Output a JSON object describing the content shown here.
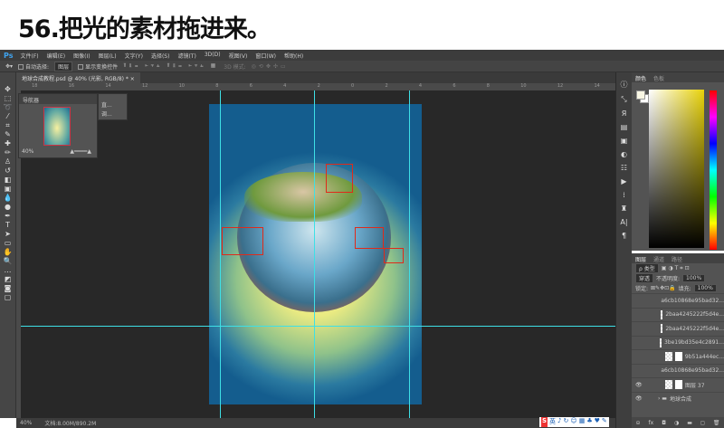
{
  "title": "56.把光的素材拖进来。",
  "app_logo": "Ps",
  "menu": [
    "文件(F)",
    "编辑(E)",
    "图像(I)",
    "图层(L)",
    "文字(Y)",
    "选择(S)",
    "滤镜(T)",
    "3D(D)",
    "视图(V)",
    "窗口(W)",
    "帮助(H)"
  ],
  "options": {
    "auto_select": "自动选择:",
    "auto_select_value": "图层",
    "show_transform": "显示变换控件",
    "mode_3d": "3D 模式:"
  },
  "doc_tab": "地球合成教程.psd @ 40% (光影, RGB/8) * ×",
  "ruler": [
    "18",
    "16",
    "14",
    "12",
    "10",
    "8",
    "6",
    "4",
    "2",
    "0",
    "2",
    "4",
    "6",
    "8",
    "10",
    "12",
    "14"
  ],
  "navigator": {
    "title": "导航器",
    "zoom": "40%"
  },
  "mini_panel": [
    "直...",
    "调..."
  ],
  "status": {
    "zoom": "40%",
    "doc": "文档:8.00M/890.2M"
  },
  "ime": [
    "S",
    "英",
    "♪",
    "↻",
    "☺",
    "▦",
    "♣",
    "♥",
    "✎"
  ],
  "color_panel": {
    "tabs": [
      "颜色",
      "色板"
    ],
    "fg": "#f8f6e4",
    "bg": "#ffffff"
  },
  "layers_panel": {
    "tabs": [
      "图层",
      "通道",
      "路径"
    ],
    "filter": "ρ 类型",
    "blend": "穿透",
    "opacity_label": "不透明度:",
    "opacity": "100%",
    "lock_label": "锁定:",
    "fill_label": "填充:",
    "fill": "100%",
    "layers": [
      {
        "name": "a6cb10868e95bad32...",
        "visible": false,
        "mask": false
      },
      {
        "name": "2baa4245222f5d4e...",
        "visible": false,
        "mask": false
      },
      {
        "name": "2baa4245222f5d4e...",
        "visible": false,
        "mask": false
      },
      {
        "name": "3be19bd35e4c2891...",
        "visible": false,
        "mask": false
      },
      {
        "name": "9b51a444ec...",
        "visible": false,
        "mask": true
      },
      {
        "name": "a6cb10868e95bad32...",
        "visible": false,
        "mask": false
      },
      {
        "name": "图层 37",
        "visible": true,
        "mask": true
      },
      {
        "name": "地球合成",
        "visible": true,
        "mask": false,
        "group": true
      }
    ],
    "footer": [
      "⊝",
      "fx",
      "◘",
      "◑",
      "▬",
      "◻",
      "🗑"
    ]
  }
}
